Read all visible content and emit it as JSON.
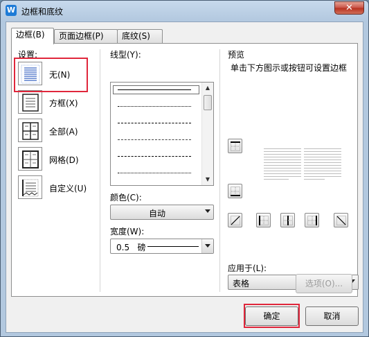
{
  "window": {
    "title": "边框和底纹",
    "app_icon_glyph": "W",
    "close_glyph": "✕"
  },
  "tabs": [
    {
      "label": "边框(B)",
      "active": true
    },
    {
      "label": "页面边框(P)",
      "active": false
    },
    {
      "label": "底纹(S)",
      "active": false
    }
  ],
  "settings": {
    "label": "设置:",
    "presets": [
      {
        "label": "无(N)",
        "icon": "no-border-icon"
      },
      {
        "label": "方框(X)",
        "icon": "box-border-icon"
      },
      {
        "label": "全部(A)",
        "icon": "all-borders-icon"
      },
      {
        "label": "网格(D)",
        "icon": "grid-border-icon"
      },
      {
        "label": "自定义(U)",
        "icon": "custom-border-icon"
      }
    ]
  },
  "line_style": {
    "label": "线型(Y):"
  },
  "color": {
    "label": "颜色(C):",
    "value": "自动"
  },
  "width": {
    "label": "宽度(W):",
    "value": "0.5   磅"
  },
  "preview": {
    "label": "预览",
    "hint": "单击下方图示或按钮可设置边框"
  },
  "apply_to": {
    "label": "应用于(L):",
    "value": "表格"
  },
  "options_button": "选项(O)...",
  "ok_button": "确定",
  "cancel_button": "取消",
  "colors": {
    "highlight": "#e0263b",
    "accent": "#1e7bd6"
  }
}
